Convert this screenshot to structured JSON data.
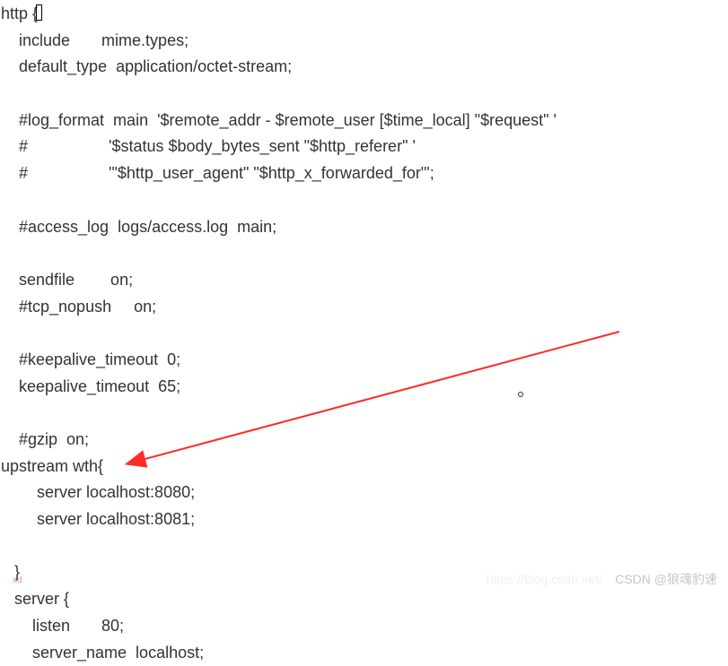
{
  "config": {
    "lines": [
      "http {",
      "    include       mime.types;",
      "    default_type  application/octet-stream;",
      "",
      "    #log_format  main  '$remote_addr - $remote_user [$time_local] \"$request\" '",
      "    #                  '$status $body_bytes_sent \"$http_referer\" '",
      "    #                  '\"$http_user_agent\" \"$http_x_forwarded_for\"';",
      "",
      "    #access_log  logs/access.log  main;",
      "",
      "    sendfile        on;",
      "    #tcp_nopush     on;",
      "",
      "    #keepalive_timeout  0;",
      "    keepalive_timeout  65;",
      "",
      "    #gzip  on;",
      "upstream wth{",
      "        server localhost:8080;",
      "        server localhost:8081;",
      "",
      "   }",
      "   server {",
      "       listen       80;",
      "       server_name  localhost;"
    ]
  },
  "watermark": {
    "text": "CSDN @狼魂豹速",
    "faded_url": "https://blog.csdn.net/",
    "sd": "sd"
  }
}
